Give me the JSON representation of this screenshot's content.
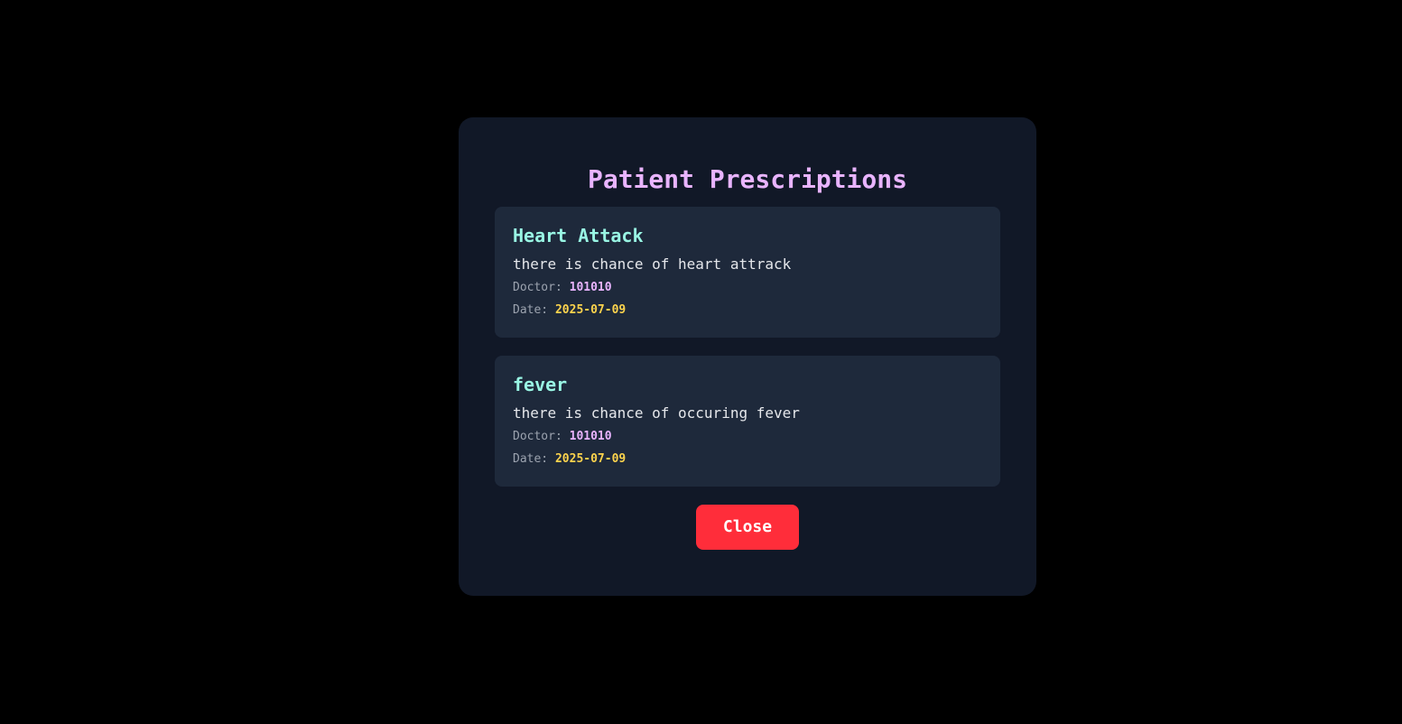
{
  "modal": {
    "title": "Patient Prescriptions",
    "close_label": "Close"
  },
  "prescriptions": [
    {
      "title": "Heart Attack",
      "description": "there is chance of heart attrack",
      "doctor_label": "Doctor:",
      "doctor": "101010",
      "date_label": "Date:",
      "date": "2025-07-09"
    },
    {
      "title": "fever",
      "description": "there is chance of occuring fever",
      "doctor_label": "Doctor:",
      "doctor": "101010",
      "date_label": "Date:",
      "date": "2025-07-09"
    }
  ],
  "colors": {
    "background": "#000000",
    "modal": "#111827",
    "card": "#1e293b",
    "title": "#e9b4ff",
    "card_title": "#99f6e4",
    "date": "#fcd34d",
    "close_button": "#ff2d3a"
  }
}
